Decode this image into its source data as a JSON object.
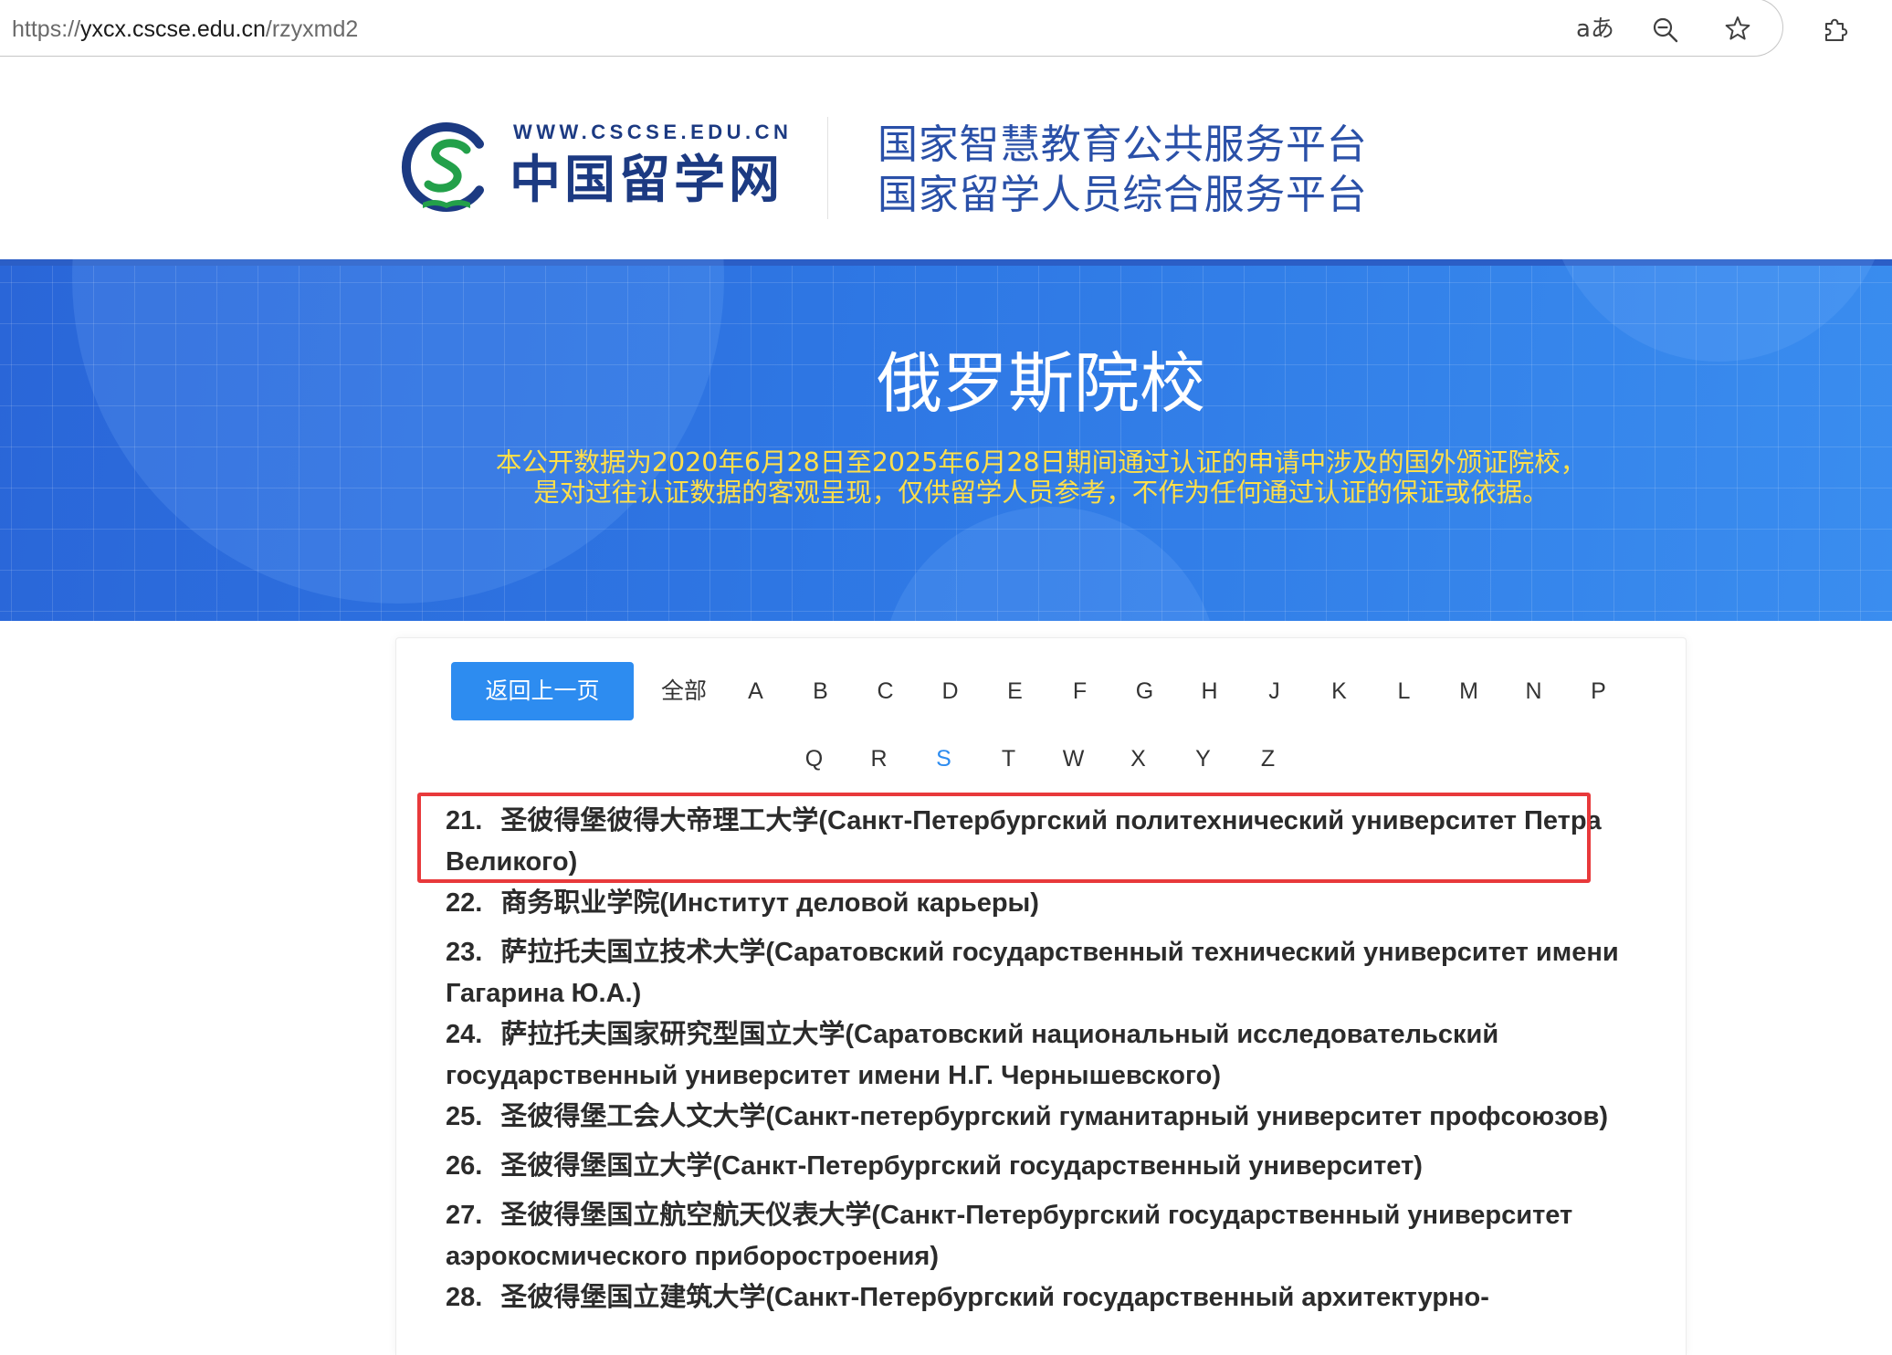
{
  "browser": {
    "url": {
      "scheme": "https://",
      "host": "yxcx.cscse.edu.cn",
      "path": "/rzyxmd2"
    },
    "translate_icon_glyph": "aあ",
    "toolbar_icons": [
      "translate-icon",
      "zoom-out-icon",
      "favorite-star-icon",
      "extensions-icon"
    ]
  },
  "header": {
    "logo_icon": "cscse-logo-mark-icon",
    "logo_url_text": "WWW.CSCSE.EDU.CN",
    "logo_name": "中国留学网",
    "platform_titles": [
      "国家智慧教育公共服务平台",
      "国家留学人员综合服务平台"
    ]
  },
  "banner": {
    "title": "俄罗斯院校",
    "notice_lines": [
      "本公开数据为2020年6月28日至2025年6月28日期间通过认证的申请中涉及的国外颁证院校，",
      "是对过往认证数据的客观呈现，仅供留学人员参考，不作为任何通过认证的保证或依据。"
    ]
  },
  "filter": {
    "back_button_label": "返回上一页",
    "all_label": "全部",
    "letters": [
      {
        "label": "A"
      },
      {
        "label": "B"
      },
      {
        "label": "C"
      },
      {
        "label": "D"
      },
      {
        "label": "E"
      },
      {
        "label": "F"
      },
      {
        "label": "G"
      },
      {
        "label": "H"
      },
      {
        "label": "J"
      },
      {
        "label": "K"
      },
      {
        "label": "L"
      },
      {
        "label": "M"
      },
      {
        "label": "N"
      },
      {
        "label": "P"
      },
      {
        "label": "Q"
      },
      {
        "label": "R"
      },
      {
        "label": "S",
        "selected": true
      },
      {
        "label": "T"
      },
      {
        "label": "W"
      },
      {
        "label": "X"
      },
      {
        "label": "Y"
      },
      {
        "label": "Z"
      }
    ]
  },
  "schools": [
    {
      "number": "21.",
      "name": "圣彼得堡彼得大帝理工大学(Санкт-Петербургский политехнический университет Петра Великого)",
      "highlighted": true
    },
    {
      "number": "22.",
      "name": "商务职业学院(Институт деловой карьеры)"
    },
    {
      "number": "23.",
      "name": "萨拉托夫国立技术大学(Саратовский государственный технический университет имени Гагарина Ю.А.)"
    },
    {
      "number": "24.",
      "name": "萨拉托夫国家研究型国立大学(Саратовский национальный исследовательский государственный университет имени Н.Г. Чернышевского)"
    },
    {
      "number": "25.",
      "name": "圣彼得堡工会人文大学(Санкт-петербургский гуманитарный университет профсоюзов)"
    },
    {
      "number": "26.",
      "name": "圣彼得堡国立大学(Санкт-Петербургский государственный университет)"
    },
    {
      "number": "27.",
      "name": "圣彼得堡国立航空航天仪表大学(Санкт-Петербургский государственный университет аэрокосмического приборостроения)"
    },
    {
      "number": "28.",
      "name": "圣彼得堡国立建筑大学(Санкт-Петербургский государственный архитектурно-"
    }
  ],
  "colors": {
    "accent": "#2d8cf0",
    "notice_text": "#ffdf4a",
    "platform_title": "#2a50a8",
    "logo_navy": "#1c3a82",
    "logo_green": "#23a04a",
    "annotation_box": "#e8393b"
  }
}
